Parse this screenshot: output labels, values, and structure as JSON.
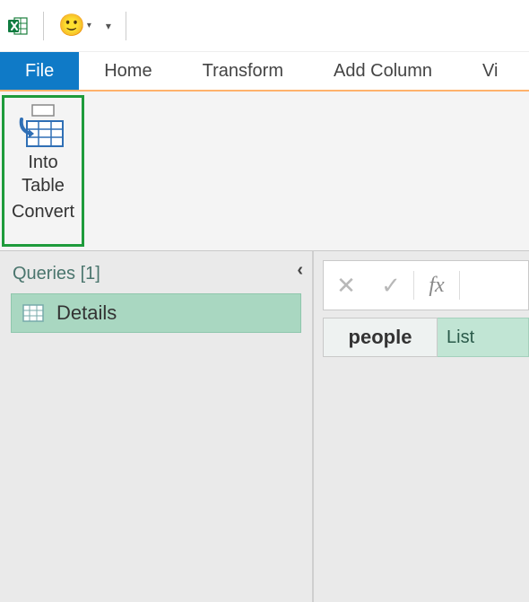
{
  "tabs": {
    "file": "File",
    "home": "Home",
    "transform": "Transform",
    "add_column": "Add Column",
    "view": "Vi"
  },
  "ribbon": {
    "into_table_line1": "Into",
    "into_table_line2": "Table",
    "convert_group": "Convert"
  },
  "queries": {
    "header": "Queries [1]",
    "items": [
      "Details"
    ]
  },
  "formula_bar": {
    "fx_label": "fx"
  },
  "record": {
    "key": "people",
    "value": "List"
  }
}
